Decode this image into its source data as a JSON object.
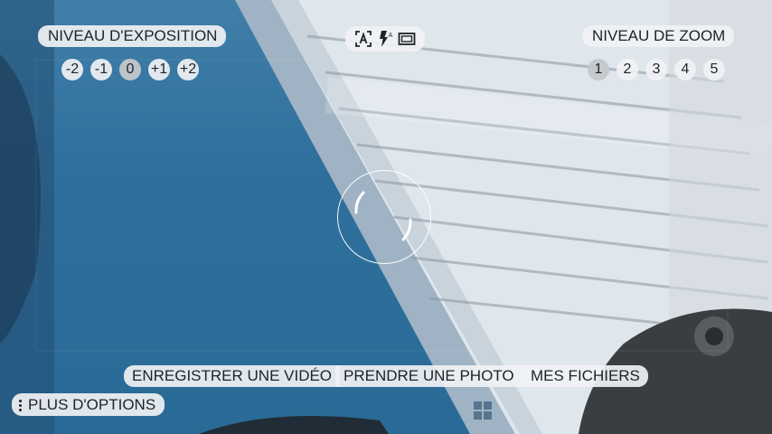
{
  "exposure": {
    "title": "NIVEAU D'EXPOSITION",
    "levels": [
      "-2",
      "-1",
      "0",
      "+1",
      "+2"
    ],
    "selected": "0"
  },
  "zoom": {
    "title": "NIVEAU DE ZOOM",
    "levels": [
      "1",
      "2",
      "3",
      "4",
      "5"
    ],
    "selected": "1"
  },
  "camera_modes": {
    "icons": [
      "auto-scene-icon",
      "flash-auto-icon",
      "aspect-ratio-icon"
    ]
  },
  "actions": {
    "record_video": "ENREGISTRER UNE VIDÉO",
    "take_photo": "PRENDRE UNE PHOTO",
    "my_files": "MES FICHIERS",
    "more_options": "PLUS D'OPTIONS"
  },
  "colors": {
    "chip_bg": "#f0f2f4",
    "chip_text": "#1f2326",
    "selected_bg": "#c3c8cc",
    "scene_blue": "#3a78a2"
  }
}
